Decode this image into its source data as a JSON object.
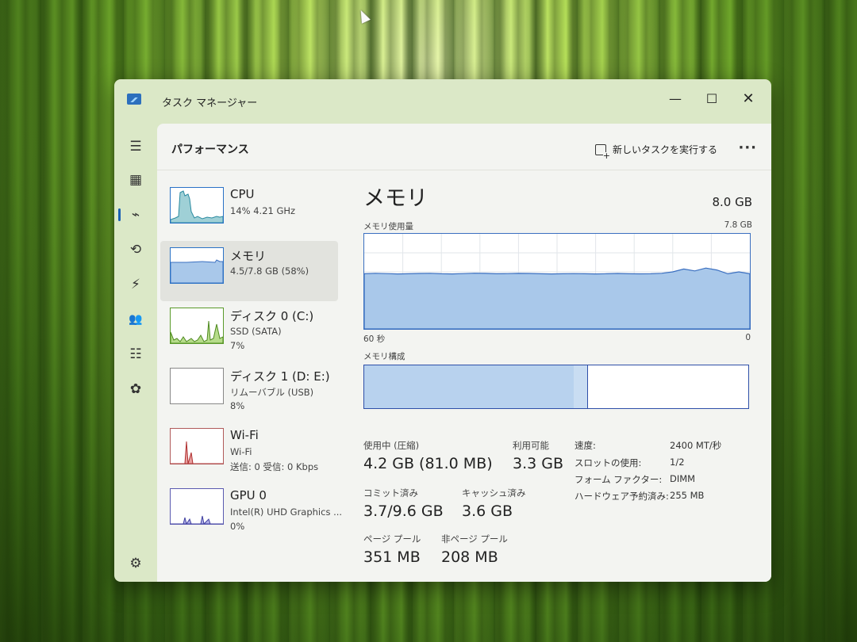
{
  "window": {
    "title": "タスク マネージャー",
    "controls": {
      "minimize": "—",
      "maximize": "☐",
      "close": "✕"
    }
  },
  "sidebar": {
    "items": [
      {
        "name": "menu-icon",
        "glyph": "☰"
      },
      {
        "name": "processes-icon",
        "glyph": "▦"
      },
      {
        "name": "performance-icon",
        "glyph": "⌁",
        "active": true
      },
      {
        "name": "app-history-icon",
        "glyph": "⟲"
      },
      {
        "name": "startup-apps-icon",
        "glyph": "⚡"
      },
      {
        "name": "users-icon",
        "glyph": "👥"
      },
      {
        "name": "details-icon",
        "glyph": "☷"
      },
      {
        "name": "services-icon",
        "glyph": "✿"
      },
      {
        "name": "settings-icon",
        "glyph": "⚙"
      }
    ]
  },
  "header": {
    "title": "パフォーマンス",
    "run_task_label": "新しいタスクを実行する",
    "more_label": "···"
  },
  "devices": [
    {
      "name": "CPU",
      "line1": "14%  4.21 GHz",
      "line2": ""
    },
    {
      "name": "メモリ",
      "line1": "4.5/7.8 GB (58%)",
      "line2": ""
    },
    {
      "name": "ディスク 0 (C:)",
      "line1": "SSD (SATA)",
      "line2": "7%"
    },
    {
      "name": "ディスク 1 (D: E:)",
      "line1": "リムーバブル (USB)",
      "line2": "8%"
    },
    {
      "name": "Wi-Fi",
      "line1": "Wi-Fi",
      "line2": "送信: 0  受信: 0 Kbps"
    },
    {
      "name": "GPU 0",
      "line1": "Intel(R) UHD Graphics ...",
      "line2": "0%"
    }
  ],
  "memory": {
    "title": "メモリ",
    "total": "8.0 GB",
    "usage_label": "メモリ使用量",
    "usage_max": "7.8 GB",
    "axis_left": "60 秒",
    "axis_right": "0",
    "composition_label": "メモリ構成",
    "composition": {
      "in_use_fraction": 0.545,
      "modified_fraction": 0.035
    },
    "stats": {
      "in_use_label": "使用中 (圧縮)",
      "in_use_value": "4.2 GB (81.0 MB)",
      "available_label": "利用可能",
      "available_value": "3.3 GB",
      "committed_label": "コミット済み",
      "committed_value": "3.7/9.6 GB",
      "cached_label": "キャッシュ済み",
      "cached_value": "3.6 GB",
      "paged_label": "ページ プール",
      "paged_value": "351 MB",
      "nonpaged_label": "非ページ プール",
      "nonpaged_value": "208 MB"
    },
    "properties": [
      {
        "label": "速度:",
        "value": "2400 MT/秒"
      },
      {
        "label": "スロットの使用:",
        "value": "1/2"
      },
      {
        "label": "フォーム ファクター:",
        "value": "DIMM"
      },
      {
        "label": "ハードウェア予約済み:",
        "value": "255 MB"
      }
    ],
    "usage_series": [
      0.58,
      0.585,
      0.582,
      0.578,
      0.58,
      0.583,
      0.585,
      0.58,
      0.578,
      0.582,
      0.586,
      0.584,
      0.58,
      0.582,
      0.584,
      0.583,
      0.58,
      0.578,
      0.58,
      0.582,
      0.58,
      0.578,
      0.58,
      0.583,
      0.58,
      0.579,
      0.58,
      0.585,
      0.6,
      0.63,
      0.61,
      0.64,
      0.62,
      0.58,
      0.6,
      0.58
    ]
  },
  "colors": {
    "accent": "#1a5fb4",
    "chart_fill": "#a9c8ea",
    "chart_line": "#3a6fc0"
  }
}
